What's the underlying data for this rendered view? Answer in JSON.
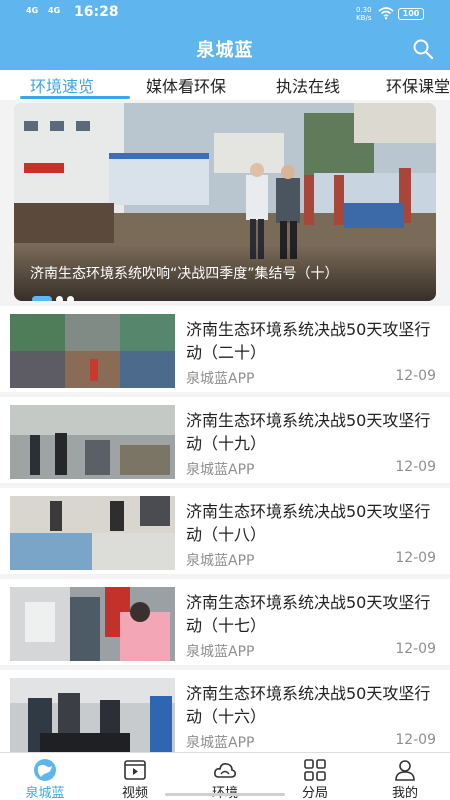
{
  "status_bar": {
    "network1": "4G",
    "network2": "4G",
    "time": "16:28",
    "speed_value": "0.30",
    "speed_unit": "KB/s",
    "battery": "100"
  },
  "header": {
    "title": "泉城蓝",
    "search_icon": "search-icon"
  },
  "tabs": [
    {
      "label": "环境速览",
      "active": true
    },
    {
      "label": "媒体看环保",
      "active": false
    },
    {
      "label": "执法在线",
      "active": false
    },
    {
      "label": "环保课堂",
      "active": false
    }
  ],
  "banner": {
    "caption": "济南生态环境系统吹响“决战四季度”集结号（十）",
    "dots": 3,
    "active_dot": 0
  },
  "news": [
    {
      "title": "济南生态环境系统决战50天攻坚行动（二十）",
      "source": "泉城蓝APP",
      "date": "12-09"
    },
    {
      "title": "济南生态环境系统决战50天攻坚行动（十九）",
      "source": "泉城蓝APP",
      "date": "12-09"
    },
    {
      "title": "济南生态环境系统决战50天攻坚行动（十八）",
      "source": "泉城蓝APP",
      "date": "12-09"
    },
    {
      "title": "济南生态环境系统决战50天攻坚行动（十七）",
      "source": "泉城蓝APP",
      "date": "12-09"
    },
    {
      "title": "济南生态环境系统决战50天攻坚行动（十六）",
      "source": "泉城蓝APP",
      "date": "12-09"
    }
  ],
  "bottom_nav": [
    {
      "label": "泉城蓝",
      "icon": "globe-icon",
      "active": true
    },
    {
      "label": "视频",
      "icon": "video-icon",
      "active": false
    },
    {
      "label": "环境",
      "icon": "cloud-icon",
      "active": false
    },
    {
      "label": "分局",
      "icon": "grid-icon",
      "active": false
    },
    {
      "label": "我的",
      "icon": "person-icon",
      "active": false
    }
  ],
  "colors": {
    "primary": "#5fb6ee",
    "active_text": "#3ea6e6"
  }
}
